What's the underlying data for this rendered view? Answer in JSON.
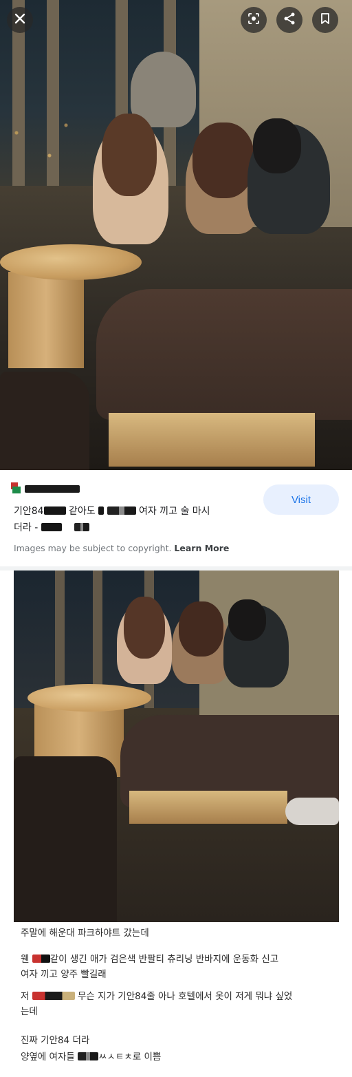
{
  "top_bar": {
    "close_icon": "close-icon",
    "lens_icon": "lens-icon",
    "share_icon": "share-icon",
    "bookmark_icon": "bookmark-icon"
  },
  "result": {
    "title_part1": "기안84",
    "title_part2": "같아도",
    "title_part3": "여자 끼고 술 마시",
    "title_part4": "더라 -",
    "visit_label": "Visit",
    "copyright_text": "Images may be subject to copyright.",
    "learn_more_label": "Learn More"
  },
  "comment": {
    "line1": "주말에 해운대 파크하야트 갔는데",
    "line2_prefix": "웬",
    "line2_suffix": "같이 생긴 애가 검은색 반팔티 츄리닝 반바지에 운동화 신고",
    "line3": "여자 끼고 양주 빨길래",
    "line4_prefix": "저",
    "line4_suffix": "무슨 지가 기안84줄 아나 호텔에서 옷이 저게 뭐냐 싶었",
    "line5": "는데",
    "line6": "진짜 기안84 더라",
    "line7_prefix": "양옆에 여자들",
    "line7_suffix": "ㅆㅅㅌㅊ로 이쁨"
  }
}
